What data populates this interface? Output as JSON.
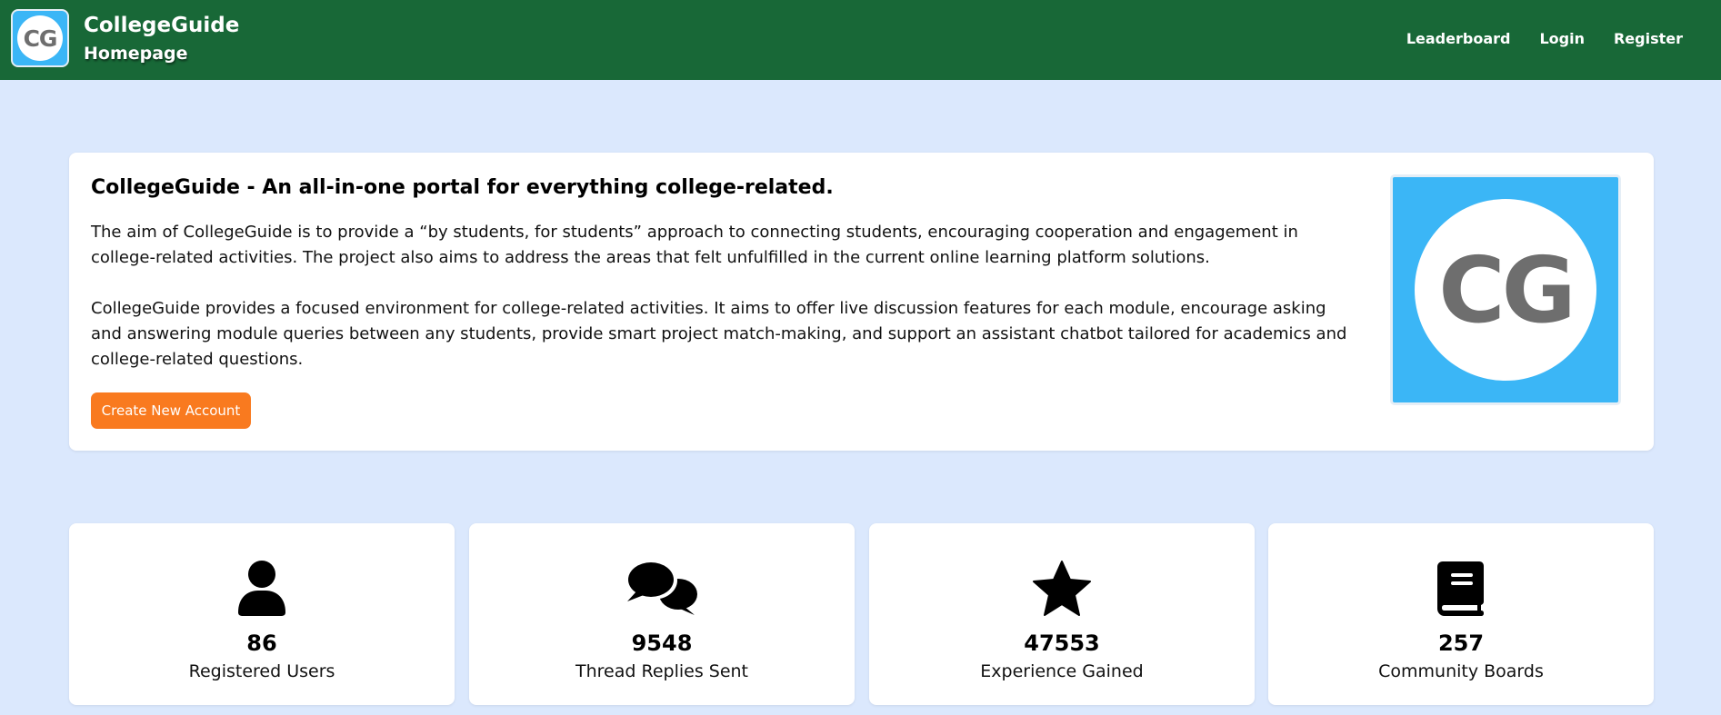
{
  "header": {
    "logo_text": "CG",
    "brand": "CollegeGuide",
    "subtitle": "Homepage",
    "nav": [
      "Leaderboard",
      "Login",
      "Register"
    ],
    "background_color": "#186837"
  },
  "hero": {
    "title": "CollegeGuide - An all-in-one portal for everything college-related.",
    "paragraph_1": "The aim of CollegeGuide is to provide a “by students, for students” approach to connecting students, encouraging cooperation and engagement in college-related activities. The project also aims to address the areas that felt unfulfilled in the current online learning platform solutions.",
    "paragraph_2": "CollegeGuide provides a focused environment for college-related activities. It aims to offer live discussion features for each module, encourage asking and answering module queries between any students, provide smart project match-making, and support an assistant chatbot tailored for academics and college-related questions.",
    "cta_label": "Create New Account",
    "cta_color": "#f97a1f",
    "logo_text": "CG",
    "logo_color": "#3bb6f6"
  },
  "stats": [
    {
      "icon": "user-icon",
      "value": "86",
      "label": "Registered Users"
    },
    {
      "icon": "comments-icon",
      "value": "9548",
      "label": "Thread Replies Sent"
    },
    {
      "icon": "star-icon",
      "value": "47553",
      "label": "Experience Gained"
    },
    {
      "icon": "book-icon",
      "value": "257",
      "label": "Community Boards"
    }
  ],
  "page_background": "#dbe8fd"
}
